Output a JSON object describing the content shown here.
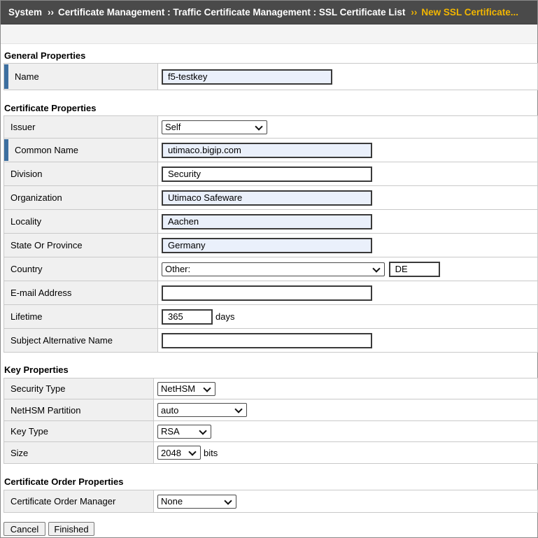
{
  "breadcrumb": {
    "items": [
      "System",
      "Certificate Management : Traffic Certificate Management : SSL Certificate List"
    ],
    "separator": "››",
    "current": "New SSL Certificate..."
  },
  "general": {
    "title": "General Properties",
    "name_label": "Name",
    "name_value": "f5-testkey"
  },
  "cert": {
    "title": "Certificate Properties",
    "issuer_label": "Issuer",
    "issuer_value": "Self",
    "common_name_label": "Common Name",
    "common_name_value": "utimaco.bigip.com",
    "division_label": "Division",
    "division_value": "Security",
    "organization_label": "Organization",
    "organization_value": "Utimaco Safeware",
    "locality_label": "Locality",
    "locality_value": "Aachen",
    "state_label": "State Or Province",
    "state_value": "Germany",
    "country_label": "Country",
    "country_select": "Other:",
    "country_code": "DE",
    "email_label": "E-mail Address",
    "email_value": "",
    "lifetime_label": "Lifetime",
    "lifetime_value": "365",
    "lifetime_unit": "days",
    "san_label": "Subject Alternative Name",
    "san_value": ""
  },
  "key": {
    "title": "Key Properties",
    "security_type_label": "Security Type",
    "security_type_value": "NetHSM",
    "partition_label": "NetHSM Partition",
    "partition_value": "auto",
    "key_type_label": "Key Type",
    "key_type_value": "RSA",
    "size_label": "Size",
    "size_value": "2048",
    "size_unit": "bits"
  },
  "order": {
    "title": "Certificate Order Properties",
    "manager_label": "Certificate Order Manager",
    "manager_value": "None"
  },
  "buttons": {
    "cancel": "Cancel",
    "finished": "Finished"
  },
  "colors": {
    "header_bg": "#4a4a4a",
    "breadcrumb_current": "#f2b600",
    "required_marker": "#3d6fa0",
    "required_input_bg": "#eaf0fb"
  }
}
